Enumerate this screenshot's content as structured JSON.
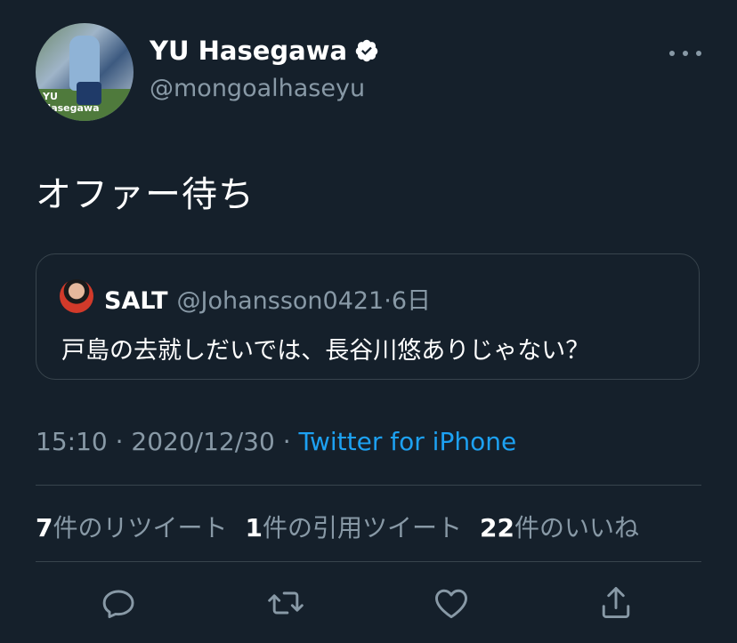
{
  "author": {
    "name": "YU Hasegawa",
    "handle": "@mongoalhaseyu",
    "avatar_watermark": "YU Hasegawa",
    "verified_icon": "verified-badge-icon"
  },
  "tweet": {
    "text": "オファー待ち"
  },
  "quoted_tweet": {
    "name": "SALT",
    "handle": "@Johansson0421",
    "separator": "·",
    "age": "6日",
    "text": "戸島の去就しだいでは、長谷川悠ありじゃない？"
  },
  "meta": {
    "time": "15:10",
    "date": "2020/12/30",
    "sep": "·",
    "source": "Twitter for iPhone"
  },
  "stats": {
    "retweets_count": "7",
    "retweets_label": "件のリツイート",
    "quotes_count": "1",
    "quotes_label": "件の引用ツイート",
    "likes_count": "22",
    "likes_label": "件のいいね"
  },
  "actions": [
    "reply-icon",
    "retweet-icon",
    "like-icon",
    "share-icon"
  ],
  "colors": {
    "background": "#15202b",
    "secondary_text": "#8899a6",
    "accent": "#1da1f2",
    "border": "#38444d"
  }
}
